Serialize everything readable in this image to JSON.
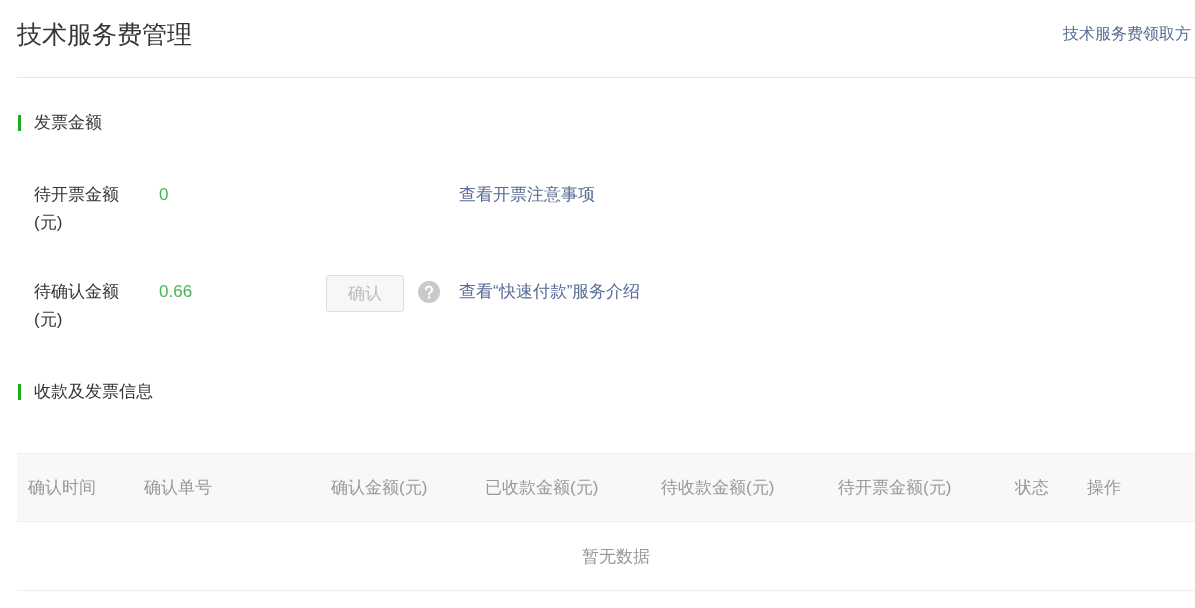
{
  "page": {
    "title": "技术服务费管理",
    "header_link": "技术服务费领取方"
  },
  "sections": [
    {
      "kind": "amounts",
      "title": "发票金额",
      "rows": [
        {
          "label": "待开票金额(元)",
          "value": "0",
          "link": "查看开票注意事项"
        },
        {
          "label": "待确认金额(元)",
          "value": "0.66",
          "button": {
            "label": "确认",
            "disabled": true
          },
          "link": "查看“快速付款”服务介绍"
        }
      ]
    },
    {
      "kind": "table",
      "title": "收款及发票信息",
      "table": {
        "columns": [
          "确认时间",
          "确认单号",
          "确认金额(元)",
          "已收款金额(元)",
          "待收款金额(元)",
          "待开票金额(元)",
          "状态",
          "操作"
        ],
        "empty_text": "暂无数据"
      }
    }
  ]
}
